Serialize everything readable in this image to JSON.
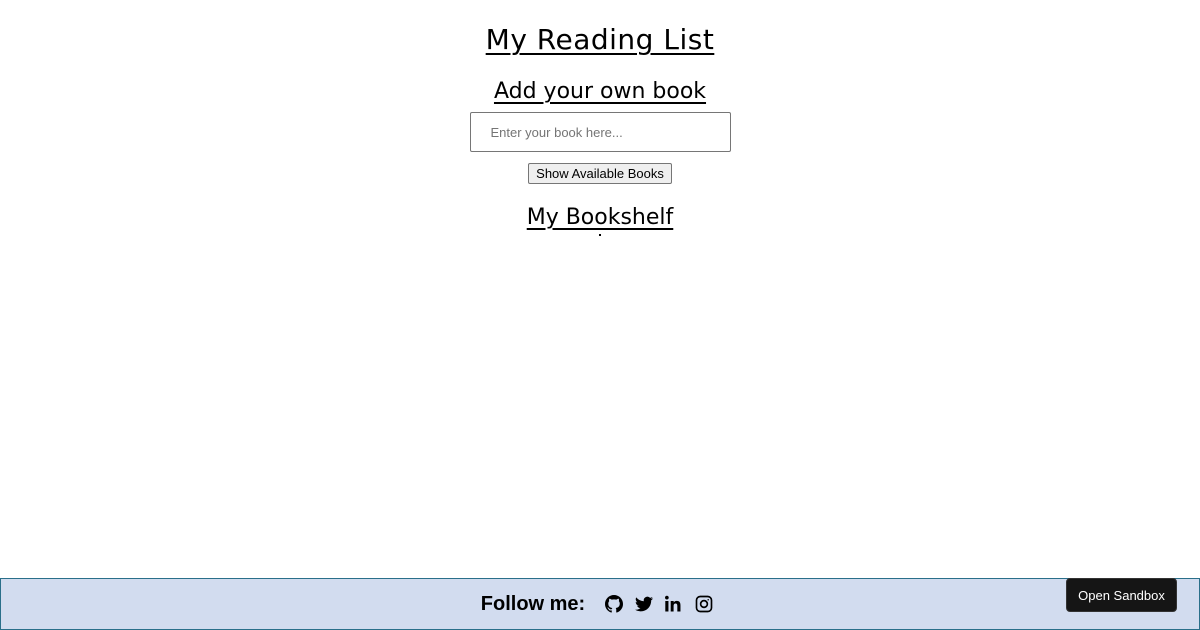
{
  "header": {
    "title": "My Reading List"
  },
  "add_book": {
    "heading": "Add your own book",
    "input_placeholder": "Enter your book here...",
    "input_value": "",
    "show_button_label": "Show Available Books"
  },
  "bookshelf": {
    "heading": "My Bookshelf",
    "items": []
  },
  "footer": {
    "follow_label": "Follow me:",
    "social_icons": [
      "github-icon",
      "twitter-icon",
      "linkedin-icon",
      "instagram-icon"
    ]
  },
  "sandbox": {
    "button_label": "Open Sandbox"
  }
}
